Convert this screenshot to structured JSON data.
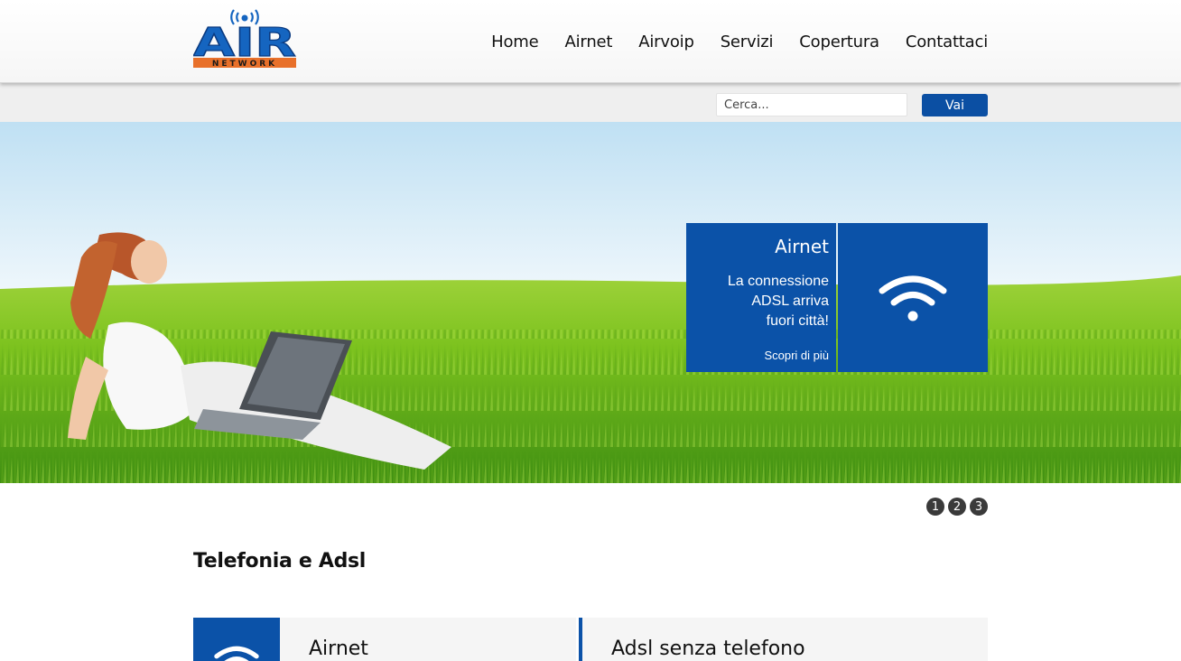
{
  "brand": {
    "logo_text": "AIR",
    "logo_subtext": "NETWORK"
  },
  "nav": {
    "items": [
      {
        "label": "Home"
      },
      {
        "label": "Airnet"
      },
      {
        "label": "Airvoip"
      },
      {
        "label": "Servizi"
      },
      {
        "label": "Copertura"
      },
      {
        "label": "Contattaci"
      }
    ]
  },
  "search": {
    "placeholder": "Cerca...",
    "button_label": "Vai"
  },
  "hero": {
    "promo_title": "Airnet",
    "promo_desc_1": "La connessione",
    "promo_desc_2": "ADSL arriva",
    "promo_desc_3": "fuori città!",
    "promo_link": "Scopri di più",
    "icon": "wifi-icon"
  },
  "pager": {
    "pages": [
      "1",
      "2",
      "3"
    ]
  },
  "section": {
    "title": "Telefonia e Adsl",
    "cards": [
      {
        "title": "Airnet",
        "icon": "wifi-icon"
      },
      {
        "title": "Adsl senza telefono"
      }
    ]
  },
  "colors": {
    "accent": "#0b52a8",
    "button": "#0b4fa3",
    "logo_orange": "#e8702a"
  }
}
